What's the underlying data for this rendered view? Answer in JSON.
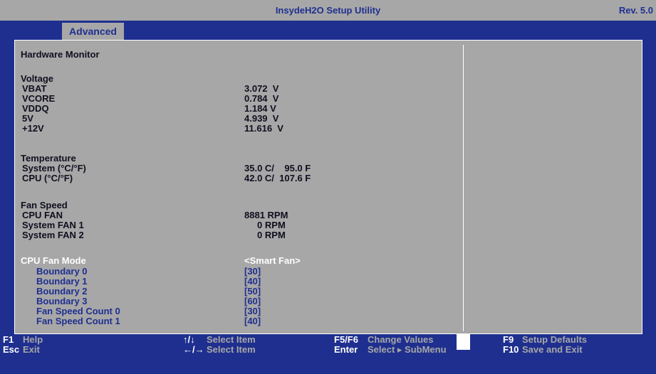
{
  "header": {
    "title": "InsydeH2O Setup Utility",
    "revision": "Rev. 5.0"
  },
  "tabs": [
    {
      "label": "Advanced",
      "active": true
    }
  ],
  "page_title": "Hardware Monitor",
  "voltage": {
    "heading": "Voltage",
    "items": [
      {
        "label": "VBAT",
        "value": "3.072  V"
      },
      {
        "label": "VCORE",
        "value": "0.784  V"
      },
      {
        "label": "VDDQ",
        "value": "1.184 V"
      },
      {
        "label": "5V",
        "value": "4.939  V"
      },
      {
        "label": "+12V",
        "value": "11.616  V"
      }
    ]
  },
  "temperature": {
    "heading": "Temperature",
    "items": [
      {
        "label": "System (°C/°F)",
        "value": "35.0 C/    95.0 F"
      },
      {
        "label": "CPU (°C/°F)",
        "value": "42.0 C/  107.6 F"
      }
    ]
  },
  "fan_speed": {
    "heading": "Fan Speed",
    "items": [
      {
        "label": "CPU FAN",
        "value": "8881 RPM"
      },
      {
        "label": "System FAN 1",
        "value": "     0 RPM"
      },
      {
        "label": "System FAN 2",
        "value": "     0 RPM"
      }
    ]
  },
  "fan_mode": {
    "label": "CPU Fan Mode",
    "value": "<Smart Fan>"
  },
  "boundaries": [
    {
      "label": "Boundary 0",
      "value": "[30]"
    },
    {
      "label": "Boundary 1",
      "value": "[40]"
    },
    {
      "label": "Boundary 2",
      "value": "[50]"
    },
    {
      "label": "Boundary 3",
      "value": "[60]"
    },
    {
      "label": "Fan Speed Count 0",
      "value": "[30]"
    },
    {
      "label": "Fan Speed Count 1",
      "value": "[40]"
    }
  ],
  "footer": {
    "f1_key": "F1",
    "f1_desc": "Help",
    "esc_key": "Esc",
    "esc_desc": "Exit",
    "updown_key": "↑/↓",
    "updown_desc": "Select Item",
    "leftright_key": "←/→",
    "leftright_desc": "Select Item",
    "f5f6_key": "F5/F6",
    "f5f6_desc": "Change Values",
    "enter_key": "Enter",
    "enter_desc": "Select ▸ SubMenu",
    "f9_key": "F9",
    "f9_desc": "Setup Defaults",
    "f10_key": "F10",
    "f10_desc": "Save and Exit"
  },
  "colors": {
    "background_blue": "#1f2f8f",
    "panel_gray": "#a7a7a7",
    "selected_white": "#ffffff",
    "text_dark": "#0f0f1f"
  }
}
